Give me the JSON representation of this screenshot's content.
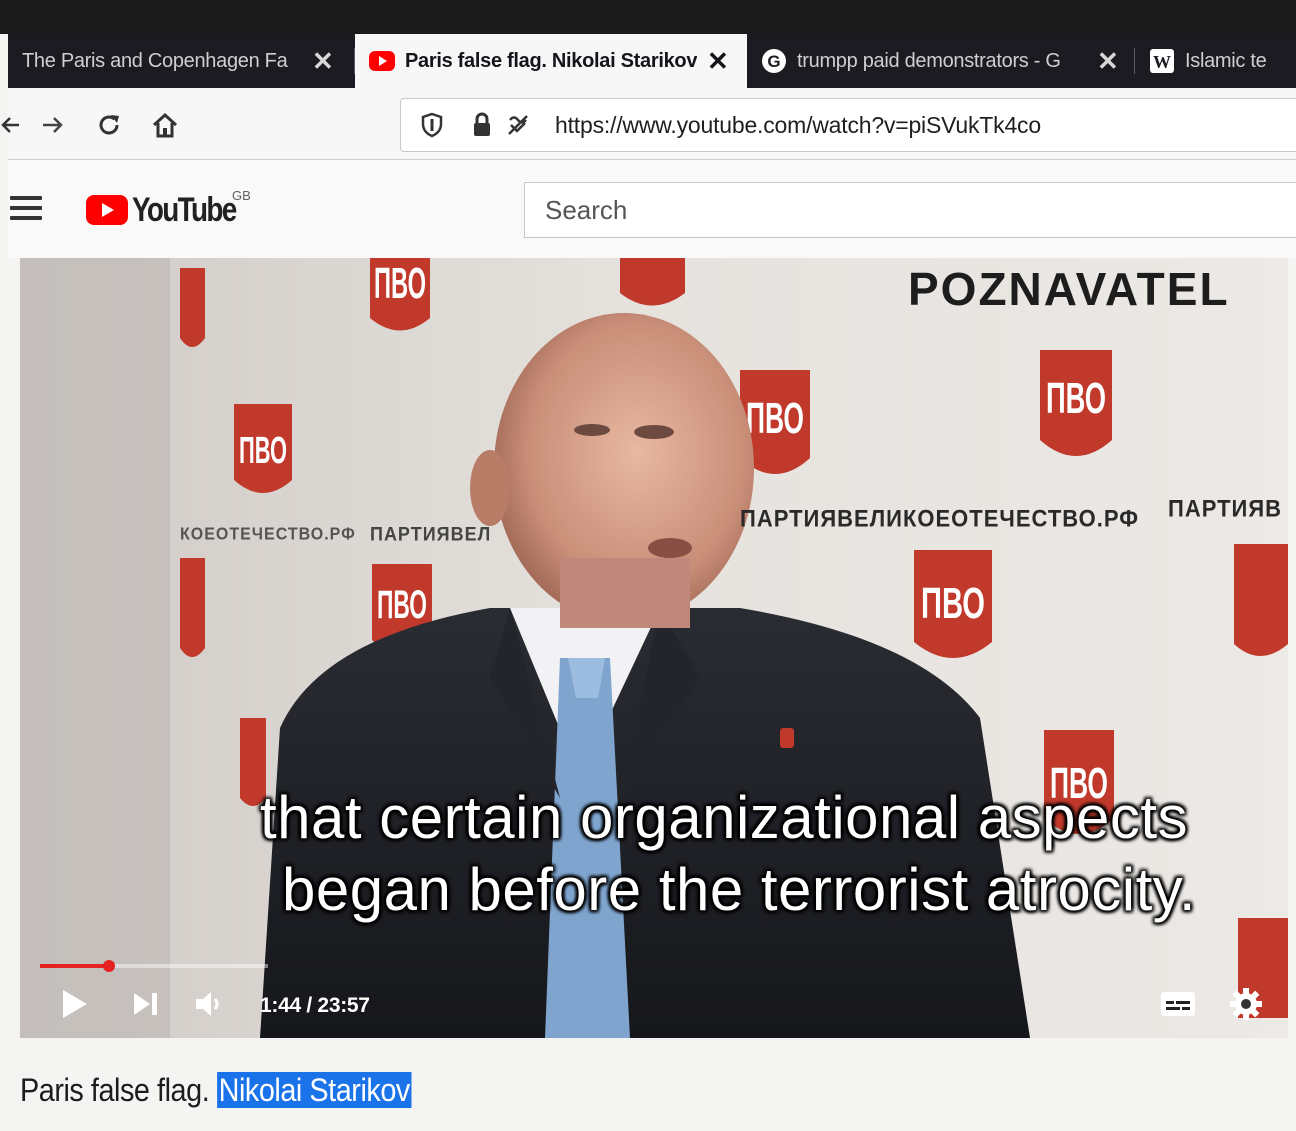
{
  "browser": {
    "tabs": [
      {
        "label": "The Paris and Copenhagen Fa",
        "favicon": "none",
        "active": false
      },
      {
        "label": "Paris false flag. Nikolai Starikov",
        "favicon": "youtube-icon",
        "active": true
      },
      {
        "label": "trumpp paid demonstrators - G",
        "favicon": "google-icon",
        "active": false
      },
      {
        "label": "Islamic te",
        "favicon": "wikipedia-icon",
        "active": false
      }
    ],
    "close_glyph": "✕",
    "url": "https://www.youtube.com/watch?v=piSVukTk4co"
  },
  "youtube": {
    "logo_text": "YouTube",
    "region": "GB",
    "search_placeholder": "Search"
  },
  "video": {
    "channel_watermark": "POZNAVATEL",
    "backdrop_slogan": "ПАРТИЯВЕЛИКОЕОТЕЧЕСТВО.РФ",
    "backdrop_slogan_right": "ПАРТИЯВ",
    "backdrop_slogan_left": "КОЕОТЕЧЕСТВО.РФ",
    "backdrop_slogan_left2": "ПАРТИЯВЕЛ",
    "logo_letters": "ПВО",
    "subtitle_line1": "that certain organizational aspects",
    "subtitle_line2": "began before the terrorist atrocity.",
    "time_current": "1:44",
    "time_total": "23:57",
    "time_display": "1:44 / 23:57",
    "played_fraction": 0.0723,
    "buffered_fraction": 0.2
  },
  "page": {
    "title_plain": "Paris false flag. ",
    "title_selected": "Nikolai Starikov"
  },
  "colors": {
    "youtube_red": "#ff0000",
    "progress_red": "#e52222",
    "selection_blue": "#1a73e8",
    "tab_strip": "#1c1b22",
    "party_red": "#c0392b"
  }
}
